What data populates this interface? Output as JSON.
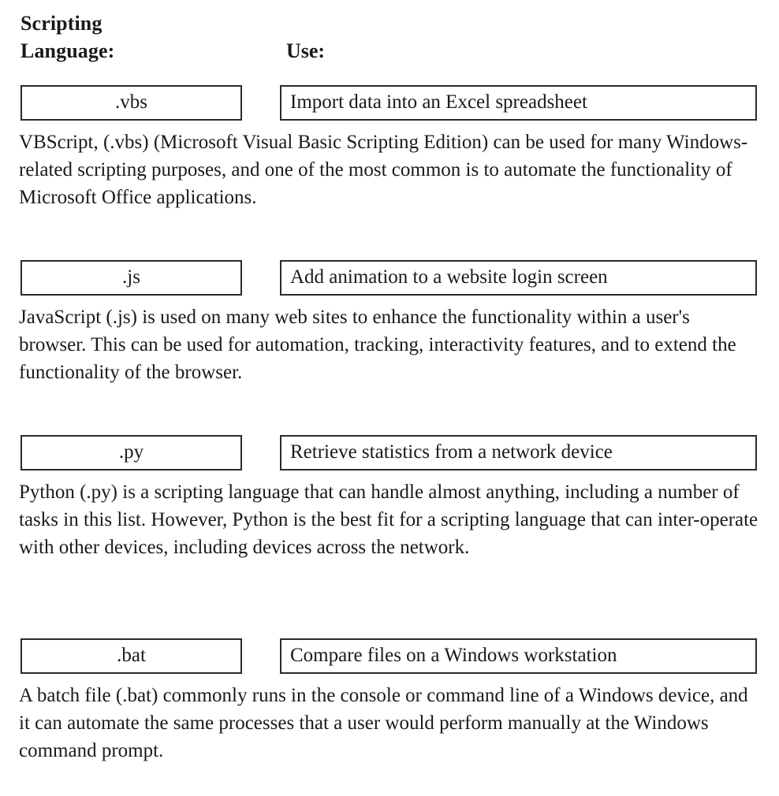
{
  "headers": {
    "language_line1": "Scripting",
    "language_line2": "Language:",
    "use": "Use:"
  },
  "rows": [
    {
      "extension": ".vbs",
      "use": "Import data into an Excel spreadsheet",
      "description": "VBScript, (.vbs) (Microsoft Visual Basic Scripting Edition) can be used for many Windows-related scripting purposes, and one of the most common is to automate the functionality of Microsoft Office applications."
    },
    {
      "extension": ".js",
      "use": "Add animation to a website login screen",
      "description": "JavaScript (.js) is used on many web sites to enhance the functionality within a user's browser. This can be used for automation, tracking, interactivity features, and to extend the functionality of the browser."
    },
    {
      "extension": ".py",
      "use": "Retrieve statistics from a network device",
      "description": "Python (.py) is a scripting language that can handle almost anything, including a number of tasks in this list. However, Python is the best fit for a scripting language that can inter-operate with other devices, including devices across the network."
    },
    {
      "extension": ".bat",
      "use": "Compare files on a Windows workstation",
      "description": "A batch file (.bat) commonly runs in the console or command line of a Windows device, and it can automate the same processes that a user would perform manually at the Windows command prompt."
    }
  ]
}
